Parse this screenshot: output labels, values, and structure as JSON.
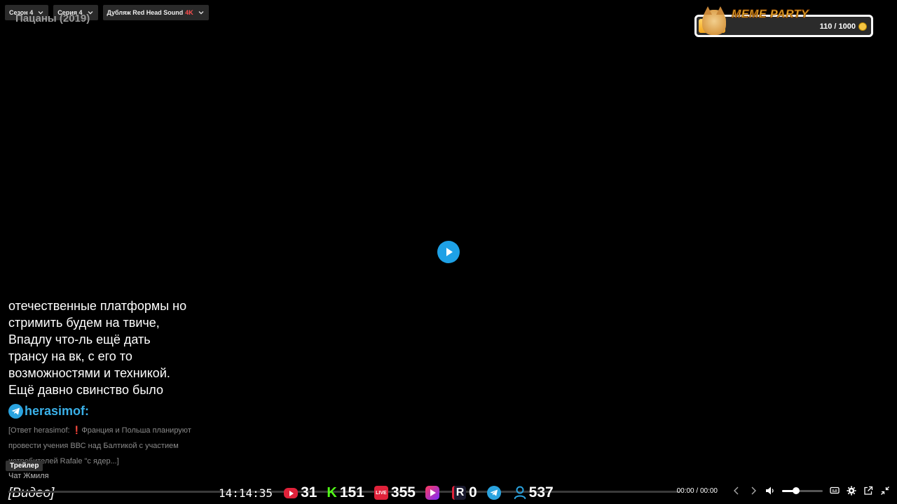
{
  "top_bar": {
    "season": "Сезон 4",
    "episode": "Серия 4",
    "dub": "Дубляж Red Head Sound",
    "quality": "4K"
  },
  "video_title": "Пацаны (2019)",
  "meme_party": {
    "title": "MEME PARTY",
    "count": "110 / 1000",
    "progress": 0.11,
    "icon": "doge-icon"
  },
  "chat": {
    "message_lines": [
      "отечественные платформы но",
      "стримить будем на твиче,",
      "Впадлу что-ль ещё дать",
      "трансу на вк, с его то",
      "возможностями и техникой.",
      "Ещё давно свинство было"
    ],
    "author": "herasimof:",
    "reply_prefix": "[Ответ herasimof: ",
    "reply_mark": "❗",
    "reply_text": "Франция и Польша планируют провести учения ВВС над Балтикой с участием истребителей Rafale \"с ядер...]",
    "trailer_label": "Трейлер",
    "chat_label": "Чат Жмиля",
    "video_tag": "[Видео]"
  },
  "stats": {
    "clock": "14:14:35",
    "youtube": "31",
    "kick": "151",
    "live": "355",
    "vkplay": "",
    "rutube": "0",
    "telegram": "",
    "viewers": "537"
  },
  "controls": {
    "time_current": "00:00",
    "time_sep": "/",
    "time_total": "00:00",
    "volume": 0.35
  },
  "colors": {
    "accent": "#1ea1e6",
    "telegram": "#2aa3df",
    "quality": "#ff4d4d"
  }
}
